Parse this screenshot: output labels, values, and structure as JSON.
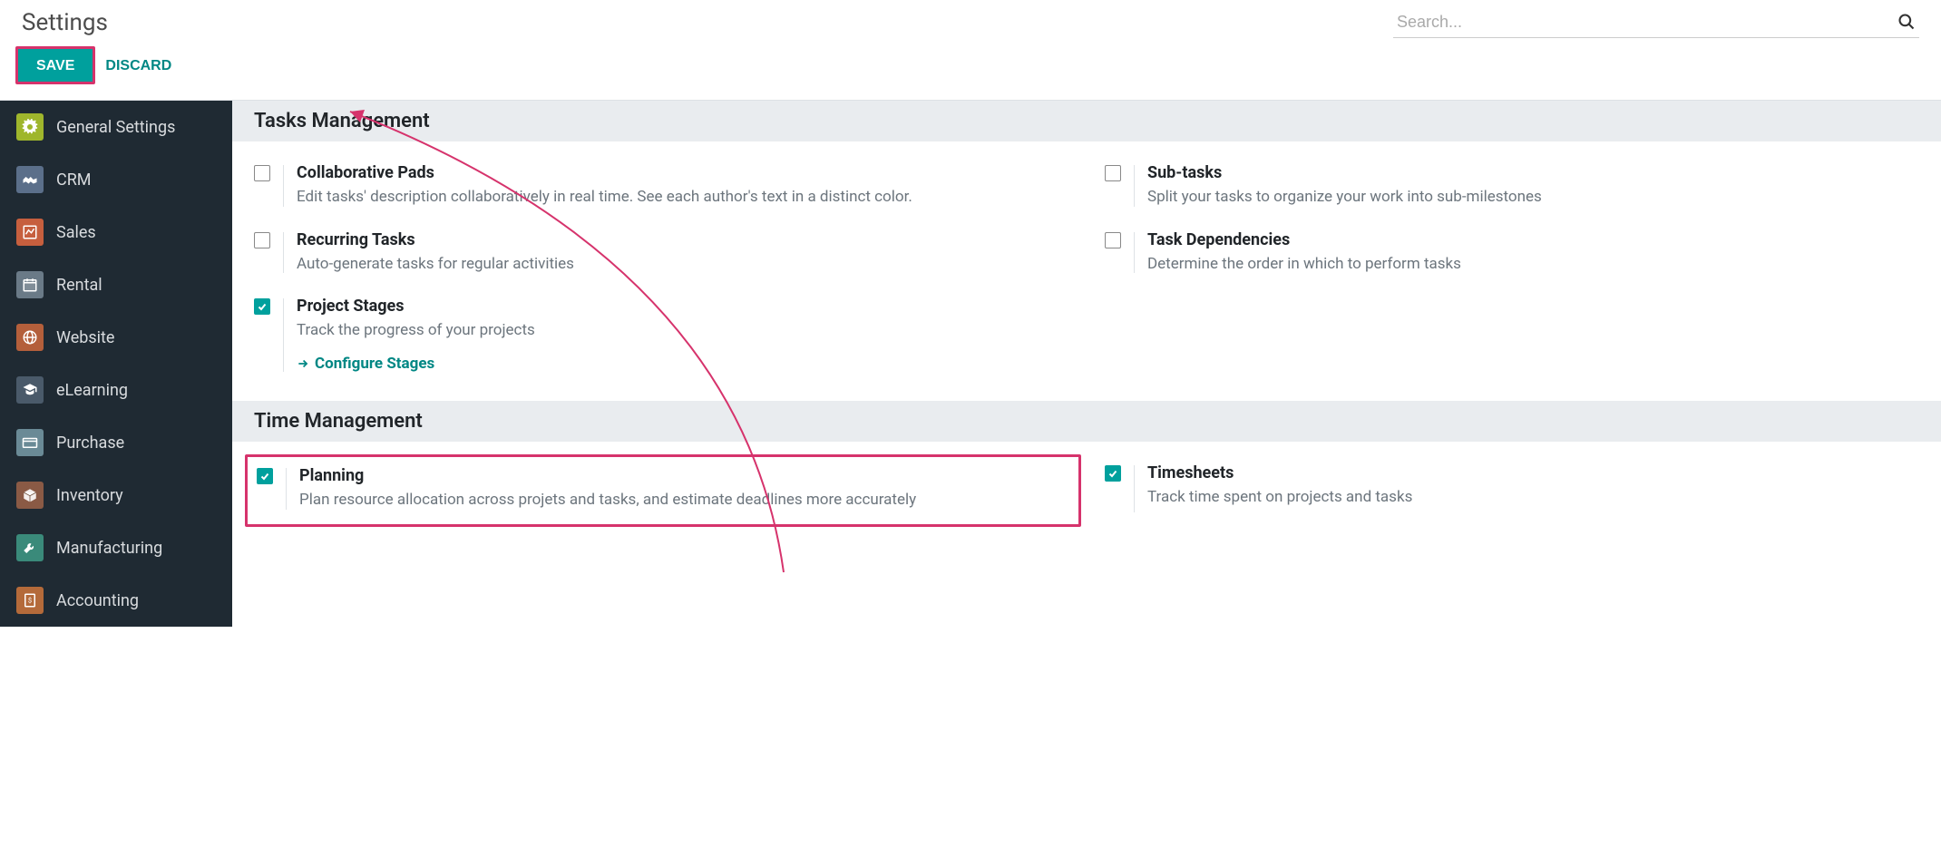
{
  "header": {
    "title": "Settings",
    "search_placeholder": "Search..."
  },
  "actions": {
    "save_label": "Save",
    "discard_label": "Discard"
  },
  "sidebar": {
    "items": [
      {
        "label": "General Settings",
        "icon": "gear-icon",
        "bg": "#9fb62c"
      },
      {
        "label": "CRM",
        "icon": "handshake-icon",
        "bg": "#5b6f8a"
      },
      {
        "label": "Sales",
        "icon": "chart-line-icon",
        "bg": "#c65f3e"
      },
      {
        "label": "Rental",
        "icon": "calendar-icon",
        "bg": "#6a7a87"
      },
      {
        "label": "Website",
        "icon": "globe-icon",
        "bg": "#b45f3b"
      },
      {
        "label": "eLearning",
        "icon": "graduation-icon",
        "bg": "#4a5a6a"
      },
      {
        "label": "Purchase",
        "icon": "creditcard-icon",
        "bg": "#6a8a96"
      },
      {
        "label": "Inventory",
        "icon": "box-icon",
        "bg": "#8a5a45"
      },
      {
        "label": "Manufacturing",
        "icon": "wrench-icon",
        "bg": "#3a8a7a"
      },
      {
        "label": "Accounting",
        "icon": "invoice-icon",
        "bg": "#b46a3a"
      }
    ]
  },
  "sections": [
    {
      "title": "Tasks Management",
      "settings": [
        {
          "title": "Collaborative Pads",
          "desc": "Edit tasks' description collaboratively in real time. See each author's text in a distinct color.",
          "checked": false
        },
        {
          "title": "Sub-tasks",
          "desc": "Split your tasks to organize your work into sub-milestones",
          "checked": false
        },
        {
          "title": "Recurring Tasks",
          "desc": "Auto-generate tasks for regular activities",
          "checked": false
        },
        {
          "title": "Task Dependencies",
          "desc": "Determine the order in which to perform tasks",
          "checked": false
        },
        {
          "title": "Project Stages",
          "desc": "Track the progress of your projects",
          "checked": true,
          "link": "Configure Stages"
        }
      ]
    },
    {
      "title": "Time Management",
      "settings": [
        {
          "title": "Planning",
          "desc": "Plan resource allocation across projets and tasks, and estimate deadlines more accurately",
          "checked": true,
          "highlighted": true
        },
        {
          "title": "Timesheets",
          "desc": "Track time spent on projects and tasks",
          "checked": true
        }
      ]
    }
  ]
}
